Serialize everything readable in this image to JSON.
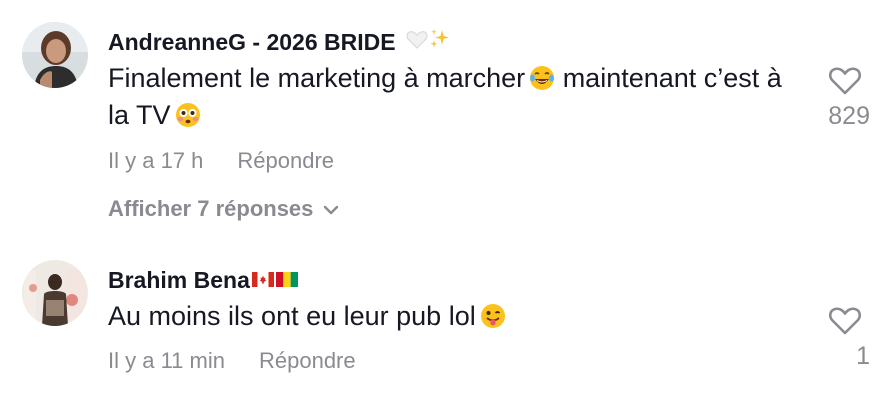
{
  "comments": [
    {
      "username": "AndreanneG - 2026 BRIDE",
      "username_emojis": [
        "white-heart-icon",
        "sparkles-icon"
      ],
      "text": "Finalement le marketing à marcher",
      "text_emoji_1": "tears-of-joy-emoji",
      "text_cont": "maintenant c’est à la TV",
      "text_emoji_2": "flushed-face-emoji",
      "time": "Il y a 17 h",
      "reply_label": "Répondre",
      "view_replies": "Afficher 7 réponses",
      "likes": "829"
    },
    {
      "username": "Brahim Bena",
      "username_emojis": [
        "canada-flag-icon",
        "guinea-flag-icon"
      ],
      "text": "Au moins ils ont eu leur pub lol",
      "text_emoji_1": "winking-face-with-tongue-emoji",
      "time": "Il y a 11 min",
      "reply_label": "Répondre",
      "likes": "1"
    }
  ],
  "colors": {
    "text": "#161823",
    "secondary": "#8a8b91"
  }
}
